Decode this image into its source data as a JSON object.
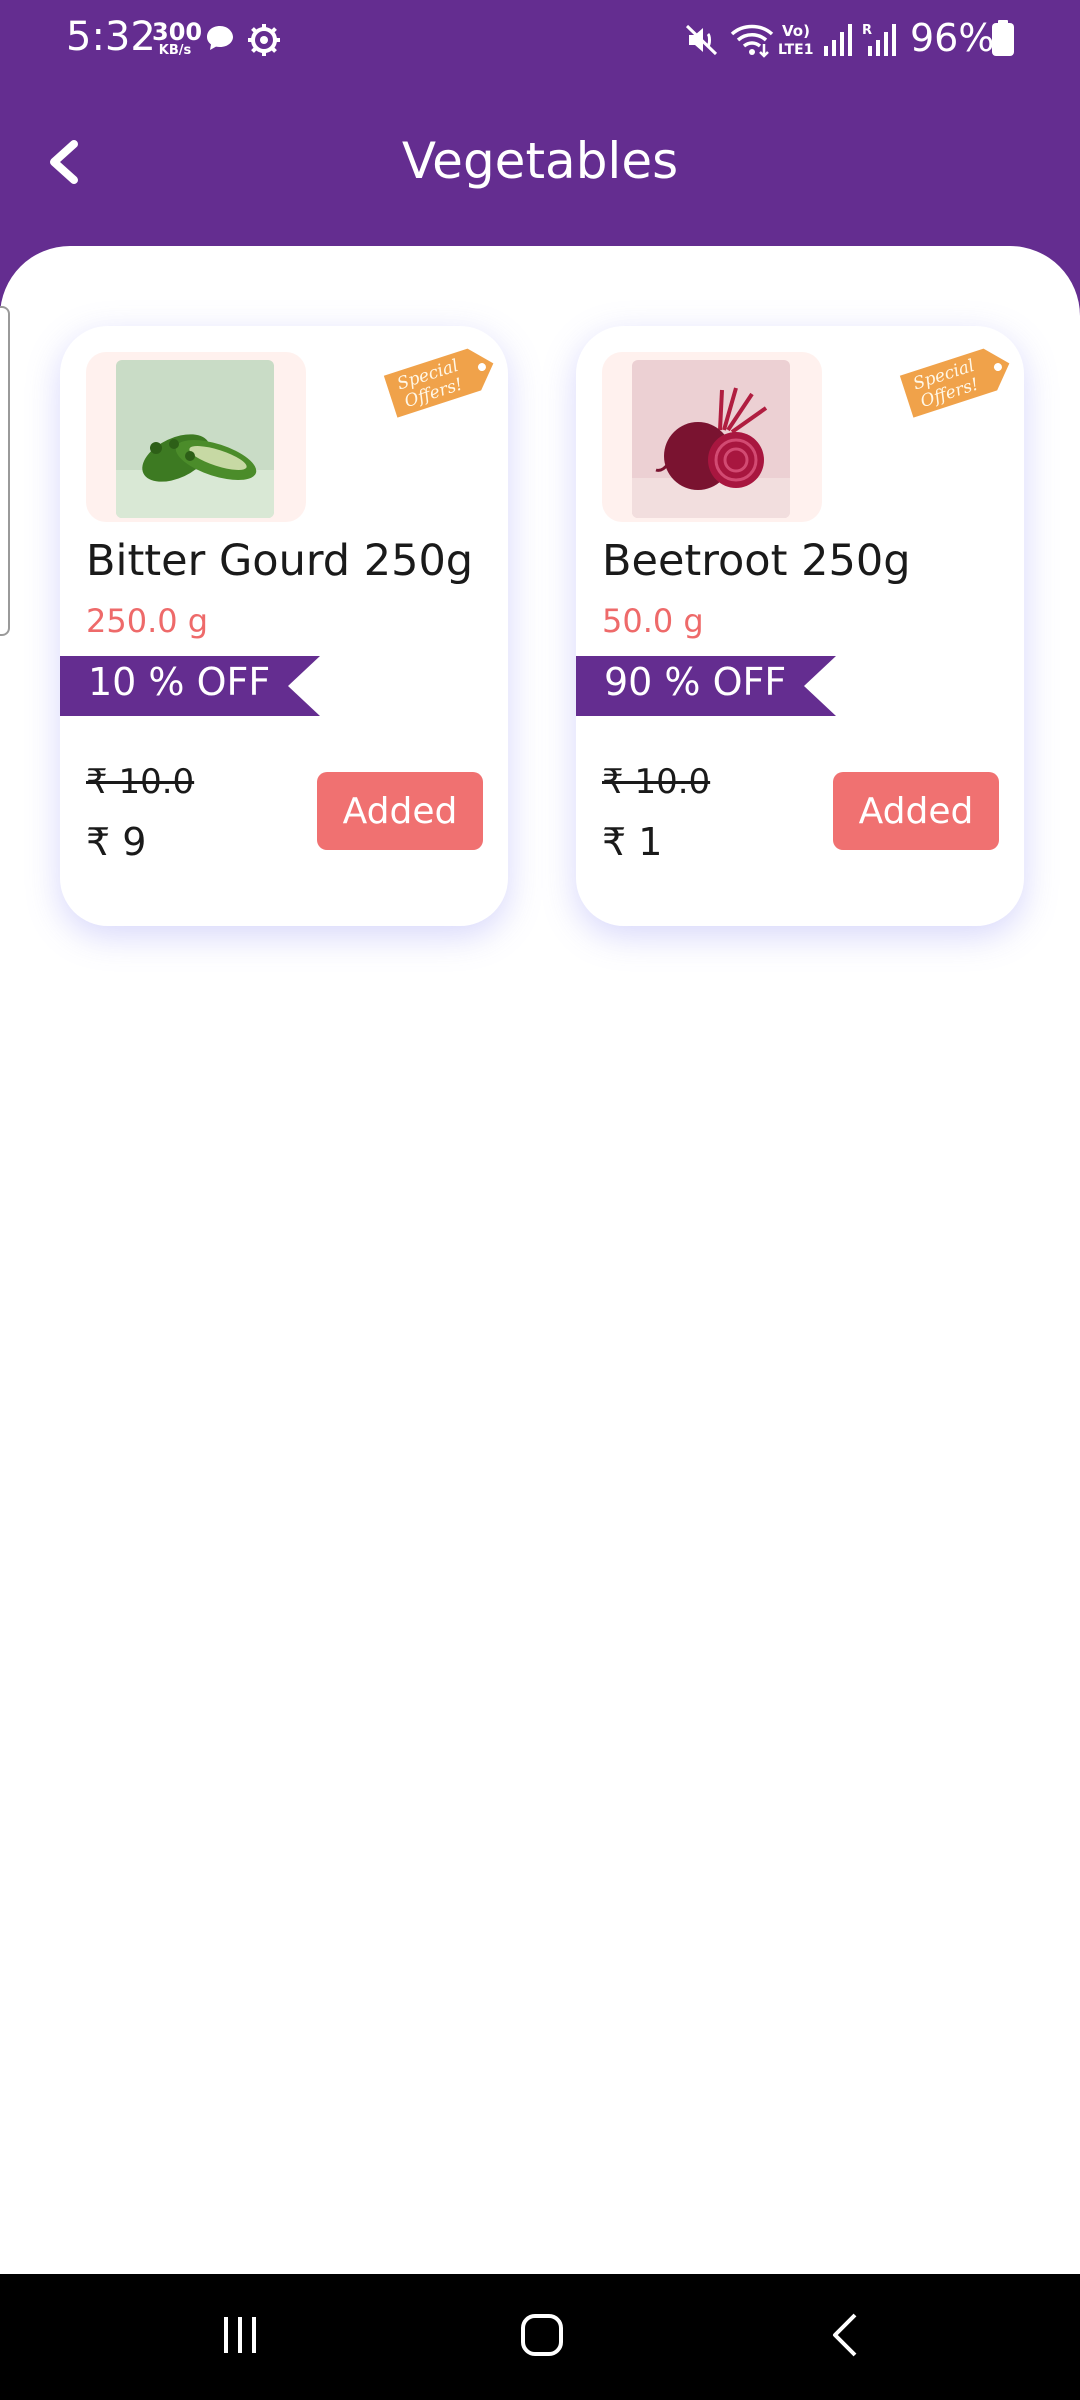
{
  "status_bar": {
    "time": "5:32",
    "speed_value": "300",
    "speed_unit": "KB/s",
    "battery_percent": "96%",
    "icons": [
      "chat-bubble-icon",
      "settings-icon",
      "mute-icon",
      "wifi-icon",
      "volte-icon",
      "signal-icon",
      "signal-roaming-icon",
      "battery-icon"
    ]
  },
  "header": {
    "title": "Vegetables",
    "back_icon": "chevron-left-icon",
    "background_color": "#642d90"
  },
  "products": [
    {
      "name": "Bitter Gourd 250g",
      "weight": "250.0 g",
      "discount": "10 % OFF",
      "original_price": "₹ 10.0",
      "price": "₹ 9",
      "button_label": "Added",
      "badge": "Special Offers!",
      "image": "bitter-gourd-image"
    },
    {
      "name": "Beetroot 250g",
      "weight": "50.0 g",
      "discount": "90 % OFF",
      "original_price": "₹ 10.0",
      "price": "₹ 1",
      "button_label": "Added",
      "badge": "Special Offers!",
      "image": "beetroot-image"
    }
  ],
  "colors": {
    "accent": "#642d90",
    "button": "#f07171",
    "weight_text": "#ee6a6a",
    "badge": "#f0a24a"
  },
  "nav_bar": {
    "icons": [
      "recent-apps-icon",
      "home-icon",
      "back-icon"
    ]
  }
}
